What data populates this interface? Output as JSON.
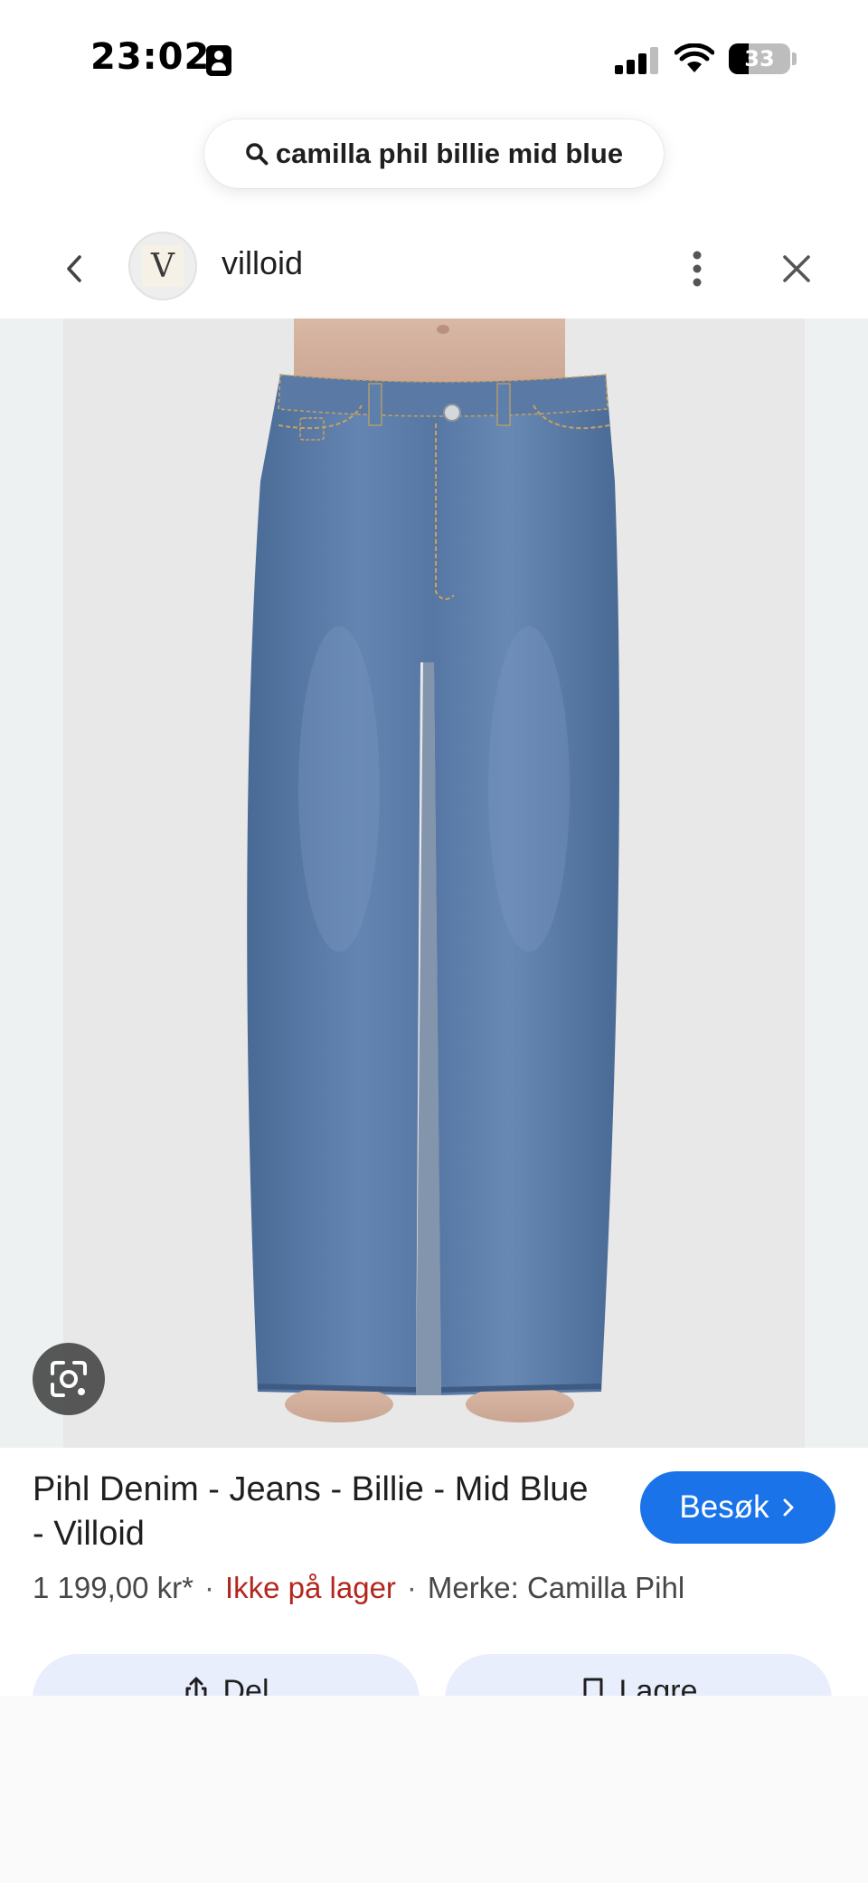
{
  "status_bar": {
    "time": "23:02",
    "battery_level": "33",
    "battery_fraction": 0.33,
    "icons": [
      "id-card-icon",
      "signal-icon",
      "wifi-icon",
      "battery-icon"
    ]
  },
  "search": {
    "query": "camilla phil billie mid blue",
    "icon": "search-icon"
  },
  "header": {
    "site_initial": "V",
    "site_name": "villoid",
    "icons": [
      "back-icon",
      "more-vertical-icon",
      "close-icon"
    ]
  },
  "image": {
    "subject": "jeans",
    "lens_icon": "lens-search-icon",
    "colors": {
      "denim": "#5b7ca8",
      "background": "#e8e8e8",
      "side": "#eef1f1"
    }
  },
  "product": {
    "title": "Pihl Denim - Jeans - Billie - Mid Blue - Villoid",
    "price": "1 199,00 kr*",
    "stock": "Ikke på lager",
    "brand": "Merke: Camilla Pihl",
    "separator": "·",
    "visit_label": "Besøk",
    "accent": "#1a73e8",
    "stock_color": "#b3261e"
  },
  "actions": {
    "share_label": "Del",
    "save_label": "Lagre",
    "icons": [
      "share-icon",
      "bookmark-icon"
    ]
  }
}
